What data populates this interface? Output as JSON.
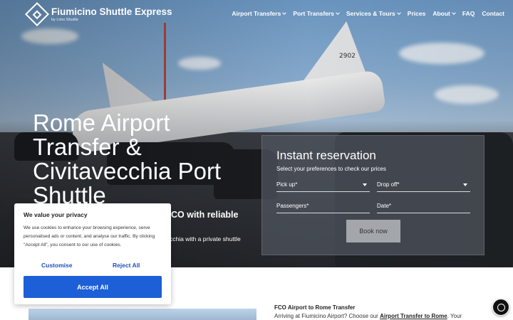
{
  "header": {
    "brand_title": "Fiumicino Shuttle Express",
    "brand_sub": "by Limo Shuttle"
  },
  "nav": {
    "items": [
      {
        "label": "Airport Transfers",
        "has_dropdown": true
      },
      {
        "label": "Port Transfers",
        "has_dropdown": true
      },
      {
        "label": "Services & Tours",
        "has_dropdown": true
      },
      {
        "label": "Prices",
        "has_dropdown": false
      },
      {
        "label": "About",
        "has_dropdown": true
      },
      {
        "label": "FAQ",
        "has_dropdown": false
      },
      {
        "label": "Contact",
        "has_dropdown": false
      }
    ]
  },
  "hero": {
    "title": "Rome Airport Transfer & Civitavecchia Port Shuttle",
    "subtitle_visible": "CO with reliable",
    "desc_visible": "cchia with a private shuttle",
    "tail_number": "2902"
  },
  "reservation": {
    "title": "Instant reservation",
    "hint": "Select your preferences to check our prices",
    "pickup": "Pick up*",
    "dropoff": "Drop off*",
    "passengers": "Passengers*",
    "date": "Date*",
    "book_label": "Book now"
  },
  "cookie": {
    "title": "We value your privacy",
    "text": "We use cookies to enhance your browsing experience, serve personalised ads or content, and analyse our traffic. By clicking \"Accept All\", you consent to our use of cookies.",
    "customise": "Customise",
    "reject": "Reject All",
    "accept": "Accept All"
  },
  "section": {
    "title": "FCO Airport to Rome Transfer",
    "text_before": "Arriving at Fiumicino Airport? Choose our ",
    "link": "Airport Transfer to Rome",
    "text_after": ". Your"
  },
  "colors": {
    "accent": "#1d5fd6",
    "link": "#1d4fbf"
  }
}
